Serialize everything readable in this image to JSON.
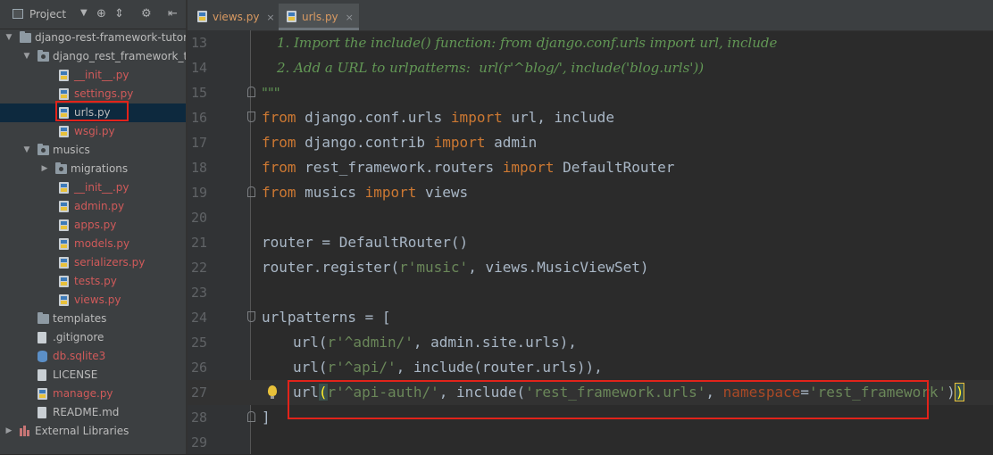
{
  "project_panel": {
    "title": "Project",
    "toolbar_icons": [
      "dropdown-icon",
      "crosshair-icon",
      "collapse-icon",
      "gear-icon",
      "hide-icon"
    ],
    "tree": [
      {
        "label": "django-rest-framework-tutor",
        "type": "folder",
        "depth": 0,
        "expanded": true,
        "color": "normal"
      },
      {
        "label": "django_rest_framework_tu",
        "type": "package",
        "depth": 1,
        "expanded": true,
        "color": "normal"
      },
      {
        "label": "__init__.py",
        "type": "py",
        "depth": 2,
        "color": "red"
      },
      {
        "label": "settings.py",
        "type": "py",
        "depth": 2,
        "color": "red"
      },
      {
        "label": "urls.py",
        "type": "py",
        "depth": 2,
        "color": "normal",
        "selected": true
      },
      {
        "label": "wsgi.py",
        "type": "py",
        "depth": 2,
        "color": "red"
      },
      {
        "label": "musics",
        "type": "package",
        "depth": 1,
        "expanded": true,
        "color": "normal"
      },
      {
        "label": "migrations",
        "type": "package",
        "depth": 2,
        "expanded": false,
        "color": "normal"
      },
      {
        "label": "__init__.py",
        "type": "py",
        "depth": 2,
        "color": "red"
      },
      {
        "label": "admin.py",
        "type": "py",
        "depth": 2,
        "color": "red"
      },
      {
        "label": "apps.py",
        "type": "py",
        "depth": 2,
        "color": "red"
      },
      {
        "label": "models.py",
        "type": "py",
        "depth": 2,
        "color": "red"
      },
      {
        "label": "serializers.py",
        "type": "py",
        "depth": 2,
        "color": "red"
      },
      {
        "label": "tests.py",
        "type": "py",
        "depth": 2,
        "color": "red"
      },
      {
        "label": "views.py",
        "type": "py",
        "depth": 2,
        "color": "red"
      },
      {
        "label": "templates",
        "type": "folder",
        "depth": 1,
        "color": "normal"
      },
      {
        "label": ".gitignore",
        "type": "txt",
        "depth": 1,
        "color": "normal"
      },
      {
        "label": "db.sqlite3",
        "type": "db",
        "depth": 1,
        "color": "red"
      },
      {
        "label": "LICENSE",
        "type": "txt",
        "depth": 1,
        "color": "normal"
      },
      {
        "label": "manage.py",
        "type": "py",
        "depth": 1,
        "color": "red"
      },
      {
        "label": "README.md",
        "type": "txt",
        "depth": 1,
        "color": "normal"
      },
      {
        "label": "External Libraries",
        "type": "lib",
        "depth": 0,
        "expanded": false,
        "color": "normal"
      }
    ]
  },
  "editor": {
    "tabs": [
      {
        "label": "views.py",
        "close": "×",
        "active": false
      },
      {
        "label": "urls.py",
        "close": "×",
        "active": true
      }
    ],
    "lines": [
      {
        "num": "13",
        "segments": [
          {
            "t": "1. Import the include() function: from django.conf.urls import url, include",
            "c": "docs"
          }
        ],
        "doc": true
      },
      {
        "num": "14",
        "segments": [
          {
            "t": "2. Add a URL to urlpatterns:  url(r'^blog/', include('blog.urls'))",
            "c": "docs"
          }
        ],
        "doc": true
      },
      {
        "num": "15",
        "segments": [
          {
            "t": "\"\"\"",
            "c": "docs"
          }
        ],
        "fold": "up"
      },
      {
        "num": "16",
        "segments": [
          {
            "t": "from",
            "c": "kw"
          },
          {
            "t": " django.conf.urls ",
            "c": "plain"
          },
          {
            "t": "import",
            "c": "kw"
          },
          {
            "t": " url, include",
            "c": "plain"
          }
        ],
        "fold": "down"
      },
      {
        "num": "17",
        "segments": [
          {
            "t": "from",
            "c": "kw"
          },
          {
            "t": " django.contrib ",
            "c": "plain"
          },
          {
            "t": "import",
            "c": "kw"
          },
          {
            "t": " admin",
            "c": "plain"
          }
        ]
      },
      {
        "num": "18",
        "segments": [
          {
            "t": "from",
            "c": "kw"
          },
          {
            "t": " rest_framework.routers ",
            "c": "plain"
          },
          {
            "t": "import",
            "c": "kw"
          },
          {
            "t": " DefaultRouter",
            "c": "plain"
          }
        ]
      },
      {
        "num": "19",
        "segments": [
          {
            "t": "from",
            "c": "kw"
          },
          {
            "t": " musics ",
            "c": "plain"
          },
          {
            "t": "import",
            "c": "kw"
          },
          {
            "t": " views",
            "c": "plain"
          }
        ],
        "fold": "up"
      },
      {
        "num": "20",
        "segments": []
      },
      {
        "num": "21",
        "segments": [
          {
            "t": "router = DefaultRouter()",
            "c": "plain"
          }
        ]
      },
      {
        "num": "22",
        "segments": [
          {
            "t": "router.register(",
            "c": "plain"
          },
          {
            "t": "r'music'",
            "c": "str"
          },
          {
            "t": ", views.MusicViewSet)",
            "c": "plain"
          }
        ]
      },
      {
        "num": "23",
        "segments": []
      },
      {
        "num": "24",
        "segments": [
          {
            "t": "urlpatterns = [",
            "c": "plain"
          }
        ],
        "fold": "down"
      },
      {
        "num": "25",
        "segments": [
          {
            "t": "url(",
            "c": "plain"
          },
          {
            "t": "r'^admin/'",
            "c": "str"
          },
          {
            "t": ", admin.site.urls),",
            "c": "plain"
          }
        ],
        "indent": true
      },
      {
        "num": "26",
        "segments": [
          {
            "t": "url(",
            "c": "plain"
          },
          {
            "t": "r'^api/'",
            "c": "str"
          },
          {
            "t": ", include(router.urls)),",
            "c": "plain"
          }
        ],
        "indent": true
      },
      {
        "num": "27",
        "segments": [
          {
            "t": "url",
            "c": "plain"
          },
          {
            "t": "(",
            "c": "bracket-match"
          },
          {
            "t": "r'^api-auth/'",
            "c": "str"
          },
          {
            "t": ", include(",
            "c": "plain"
          },
          {
            "t": "'rest_framework.urls'",
            "c": "str"
          },
          {
            "t": ", ",
            "c": "plain"
          },
          {
            "t": "namespace",
            "c": "param"
          },
          {
            "t": "=",
            "c": "plain"
          },
          {
            "t": "'rest_framework'",
            "c": "str"
          },
          {
            "t": ")",
            "c": "plain"
          },
          {
            "t": ")",
            "c": "bracket-match caret-box"
          }
        ],
        "indent": true,
        "current": true,
        "bulb": true
      },
      {
        "num": "28",
        "segments": [
          {
            "t": "]",
            "c": "plain"
          }
        ],
        "fold": "up"
      },
      {
        "num": "29",
        "segments": []
      }
    ]
  }
}
